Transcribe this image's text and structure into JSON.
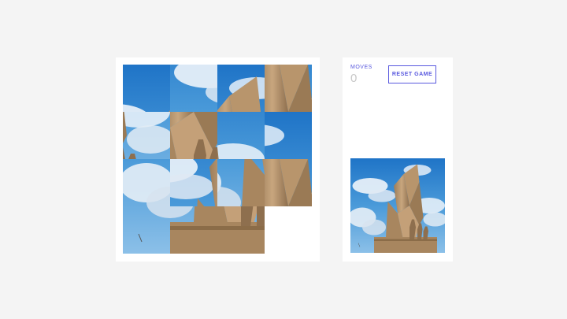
{
  "game": {
    "moves_label": "MOVES",
    "moves_count": "0",
    "reset_label": "RESET GAME",
    "accent_color": "#5a5adf",
    "grid_size": 4,
    "tile_count": 15,
    "empty_position": "bottom-right"
  },
  "icons": {
    "tile_image": "monument-photo",
    "preview_image": "monument-photo"
  }
}
